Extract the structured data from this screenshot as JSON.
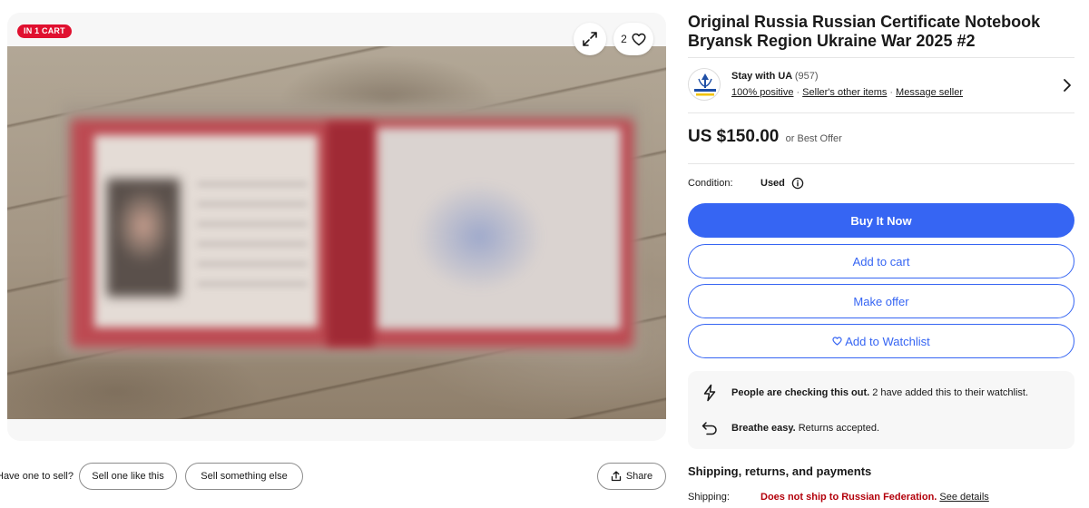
{
  "gallery": {
    "cart_badge": "IN 1 CART",
    "watch_count": "2",
    "icons": {
      "expand": "expand-icon",
      "watch": "heart-icon"
    }
  },
  "below_gallery": {
    "sell_prompt": "Have one to sell?",
    "sell_one_label": "Sell one like this",
    "sell_else_label": "Sell something else",
    "share_label": "Share"
  },
  "listing": {
    "title": "Original Russia Russian Certificate Notebook Bryansk Region Ukraine War 2025 #2"
  },
  "seller": {
    "name": "Stay with UA",
    "feedback_count": "(957)",
    "positive": "100% positive",
    "other_items": "Seller's other items",
    "message": "Message seller"
  },
  "price": {
    "amount": "US $150.00",
    "offer_note": "or Best Offer"
  },
  "condition": {
    "label": "Condition:",
    "value": "Used"
  },
  "actions": {
    "buy_now": "Buy It Now",
    "add_to_cart": "Add to cart",
    "make_offer": "Make offer",
    "watchlist": "Add to Watchlist"
  },
  "highlights": {
    "checking_bold": "People are checking this out.",
    "checking_rest": "2 have added this to their watchlist.",
    "returns_bold": "Breathe easy.",
    "returns_rest": "Returns accepted."
  },
  "shipping": {
    "heading": "Shipping, returns, and payments",
    "label": "Shipping:",
    "value": "Does not ship to Russian Federation.",
    "details_link": "See details"
  },
  "colors": {
    "accent": "#3665f3",
    "badge": "#e0102f",
    "warning": "#b3000b"
  }
}
